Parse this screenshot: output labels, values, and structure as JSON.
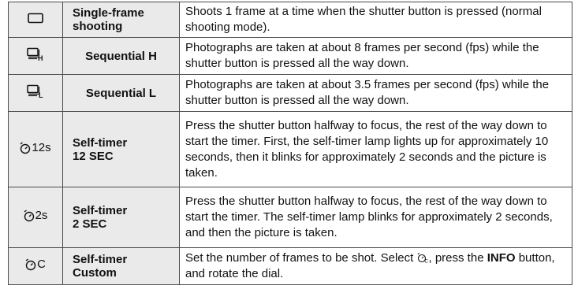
{
  "modes": [
    {
      "name_line1": "Single-frame",
      "name_line2": "shooting",
      "icon": "single-frame-icon",
      "icon_text": "",
      "description": "Shoots 1 frame at a time when the shutter button is pressed (normal shooting mode)."
    },
    {
      "name_line1": "Sequential H",
      "name_line2": "",
      "icon": "sequential-h-icon",
      "icon_text": "",
      "description": "Photographs are taken at about 8 frames per second (fps) while the shutter button is pressed all the way down."
    },
    {
      "name_line1": "Sequential L",
      "name_line2": "",
      "icon": "sequential-l-icon",
      "icon_text": "",
      "description": "Photographs are taken at about 3.5 frames per second (fps) while the shutter button is pressed all the way down."
    },
    {
      "name_line1": "Self-timer",
      "name_line2": "12 SEC",
      "icon": "self-timer-icon",
      "icon_text": "12s",
      "description": "Press the shutter button halfway to focus, the rest of the way down to start the timer. First, the self-timer lamp lights up for approximately 10 seconds, then it blinks for approximately 2 seconds and the picture is taken."
    },
    {
      "name_line1": "Self-timer",
      "name_line2": "2 SEC",
      "icon": "self-timer-icon",
      "icon_text": "2s",
      "description": "Press the shutter button halfway to focus, the rest of the way down to start the timer. The self-timer lamp blinks for approximately 2 seconds, and then the picture is taken."
    },
    {
      "name_line1": "Self-timer",
      "name_line2": "Custom",
      "icon": "self-timer-icon",
      "icon_text": "C",
      "description_part1": "Set the number of frames to be shot. Select ",
      "description_icon": "self-timer-custom-icon",
      "description_part2": ", press the ",
      "description_bold": "INFO",
      "description_part3": " button, and rotate the dial."
    }
  ]
}
